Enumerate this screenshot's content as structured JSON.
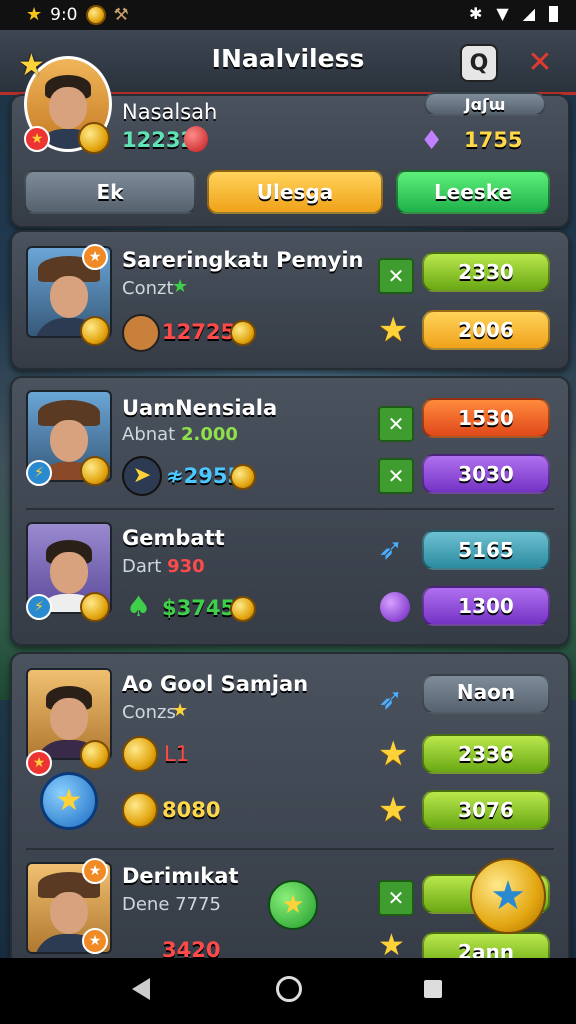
{
  "status": {
    "time": "9:0",
    "icons": [
      "star-icon",
      "coin-icon",
      "hammer-icon"
    ],
    "right_icons": [
      "bluetooth-icon",
      "wifi-icon",
      "signal-icon",
      "battery-icon"
    ]
  },
  "header": {
    "title": "INaalviless"
  },
  "profile": {
    "name": "Nasalsah",
    "coins": "12232",
    "gems": "1755",
    "top_value": "Jɑʃɯ"
  },
  "tabs": [
    {
      "label": "Ek"
    },
    {
      "label": "Ulesga"
    },
    {
      "label": "Leeske"
    }
  ],
  "cards": [
    {
      "name": "Sareringkatı Pemyin",
      "sub": "Conzt",
      "value": "12725",
      "pill1": "2330",
      "pill2": "2006"
    },
    {
      "name": "UamNensiala",
      "sub_label": "Abnat",
      "sub_value": "2.000",
      "value": "≉2955",
      "pill1": "1530",
      "pill2": "3030"
    },
    {
      "name": "Gembatt",
      "sub_label": "Dart",
      "sub_value": "930",
      "value": "$3745",
      "pill1": "5165",
      "pill2": "1300"
    },
    {
      "name": "Ao Gool Samjan",
      "sub": "Conzs",
      "value1": "L1",
      "value2": "8080",
      "pill0": "Naon",
      "pill1": "2336",
      "pill2": "3076"
    },
    {
      "name": "Derimıkat",
      "sub": "Dene 7775",
      "value": "3420",
      "pill1": "N",
      "pill2": "2ann"
    }
  ],
  "colors": {
    "accent_red": "#b7302a",
    "green": "#6aa814",
    "yellow": "#f0a21a",
    "orange": "#e0481a",
    "purple": "#7433c4",
    "teal": "#2c8aa0"
  }
}
